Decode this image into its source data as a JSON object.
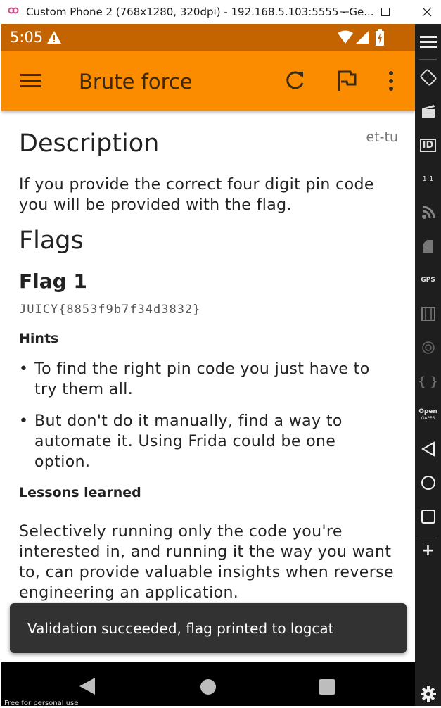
{
  "window": {
    "title": "Custom Phone 2 (768x1280, 320dpi) - 192.168.5.103:5555 - Ge...",
    "minimize_icon": "minimize-icon",
    "maximize_icon": "maximize-icon",
    "close_icon": "close-icon"
  },
  "statusbar": {
    "time": "5:05"
  },
  "appbar": {
    "title": "Brute force",
    "actions": [
      "refresh-icon",
      "flag-icon",
      "more-vert-icon"
    ]
  },
  "challenge": {
    "description_heading": "Description",
    "author": "et-tu",
    "description": "If you provide the correct four digit pin code you will be provided with the flag.",
    "flags_heading": "Flags",
    "flag1_heading": "Flag 1",
    "flag1_value": "JUICY{8853f9b7f34d3832}",
    "hints_heading": "Hints",
    "hints": [
      "To find the right pin code you just have to try them all.",
      "But don't do it manually, find a way to automate it. Using Frida could be one option."
    ],
    "lessons_heading": "Lessons learned",
    "lessons": "Selectively running only the code you're interested in, and running it the way you want to, can provide valuable insights when reverse engineering an application."
  },
  "toast": {
    "message": "Validation succeeded, flag printed to logcat"
  },
  "watermark": "Free for personal use",
  "sidebar": {
    "items": [
      "hamburger-icon",
      "rotate-icon",
      "video-icon",
      "ID",
      "1:1",
      "rss-icon",
      "sim-icon",
      "GPS",
      "film-icon",
      "fingerprint-icon",
      "{ }",
      "Open GAPPS",
      "back-icon",
      "home-icon",
      "recents-icon",
      "+",
      "settings-icon"
    ],
    "id_label": "ID",
    "ratio_label": "1:1",
    "gps_label": "GPS",
    "braces_label": "{ }",
    "gapps_line1": "Open",
    "gapps_line2": "GAPPS",
    "plus_label": "+"
  },
  "colors": {
    "status_bar": "#c46400",
    "app_bar": "#fb8c00",
    "toast": "#323232"
  }
}
